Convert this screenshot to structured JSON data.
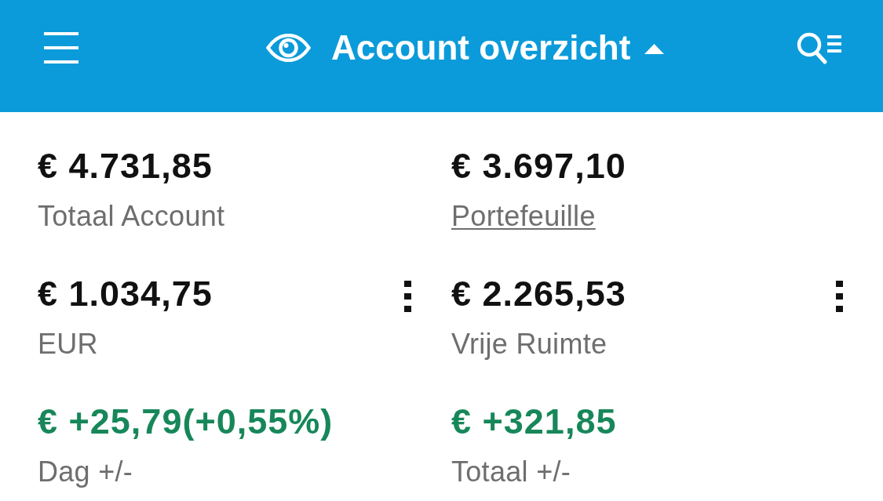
{
  "header": {
    "title": "Account overzicht",
    "expanded": true
  },
  "cells": [
    {
      "kind": "balance",
      "value": "€ 4.731,85",
      "label": "Totaal Account",
      "link": false,
      "menu": false
    },
    {
      "kind": "balance",
      "value": "€ 3.697,10",
      "label": "Portefeuille",
      "link": true,
      "menu": false
    },
    {
      "kind": "balance",
      "value": "€ 1.034,75",
      "label": "EUR",
      "link": false,
      "menu": true
    },
    {
      "kind": "balance",
      "value": "€ 2.265,53",
      "label": "Vrije Ruimte",
      "link": false,
      "menu": true
    },
    {
      "kind": "change",
      "value": "€ +25,79(+0,55%)",
      "label": "Dag +/-",
      "link": false,
      "menu": false
    },
    {
      "kind": "change",
      "value": "€ +321,85",
      "label": "Totaal +/-",
      "link": false,
      "menu": false
    }
  ]
}
